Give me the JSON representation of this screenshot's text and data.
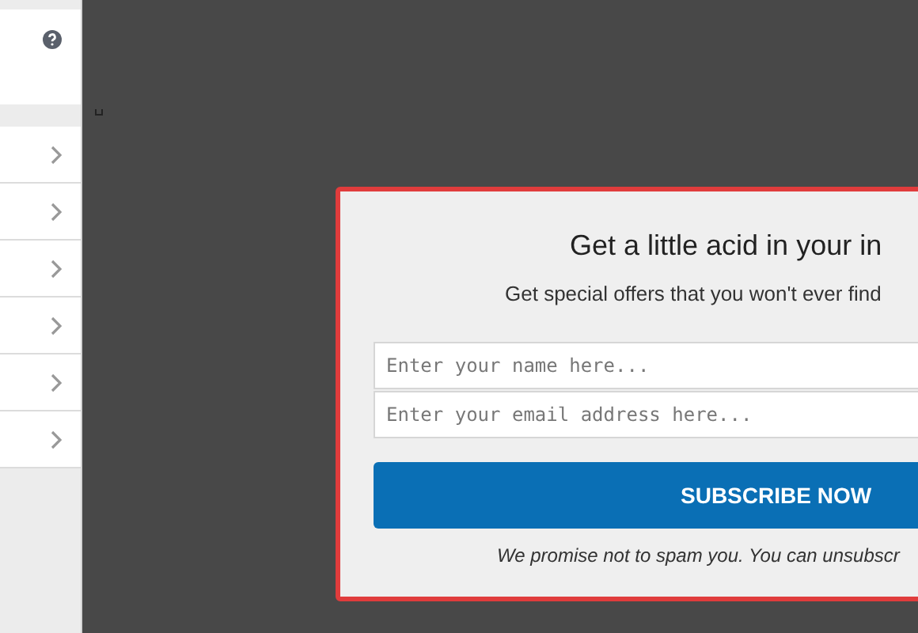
{
  "sidebar": {
    "rows": [
      {
        "kind": "link"
      },
      {
        "kind": "link"
      },
      {
        "kind": "link"
      },
      {
        "kind": "link"
      },
      {
        "kind": "link"
      },
      {
        "kind": "link"
      }
    ]
  },
  "popup": {
    "title": "Get a little acid in your in",
    "subtitle": "Get special offers that you won't ever find",
    "fields": [
      {
        "placeholder": "Enter your name here..."
      },
      {
        "placeholder": "Enter your email address here..."
      }
    ],
    "button": "SUBSCRIBE NOW",
    "note": "We promise not to spam you. You can unsubscr"
  }
}
